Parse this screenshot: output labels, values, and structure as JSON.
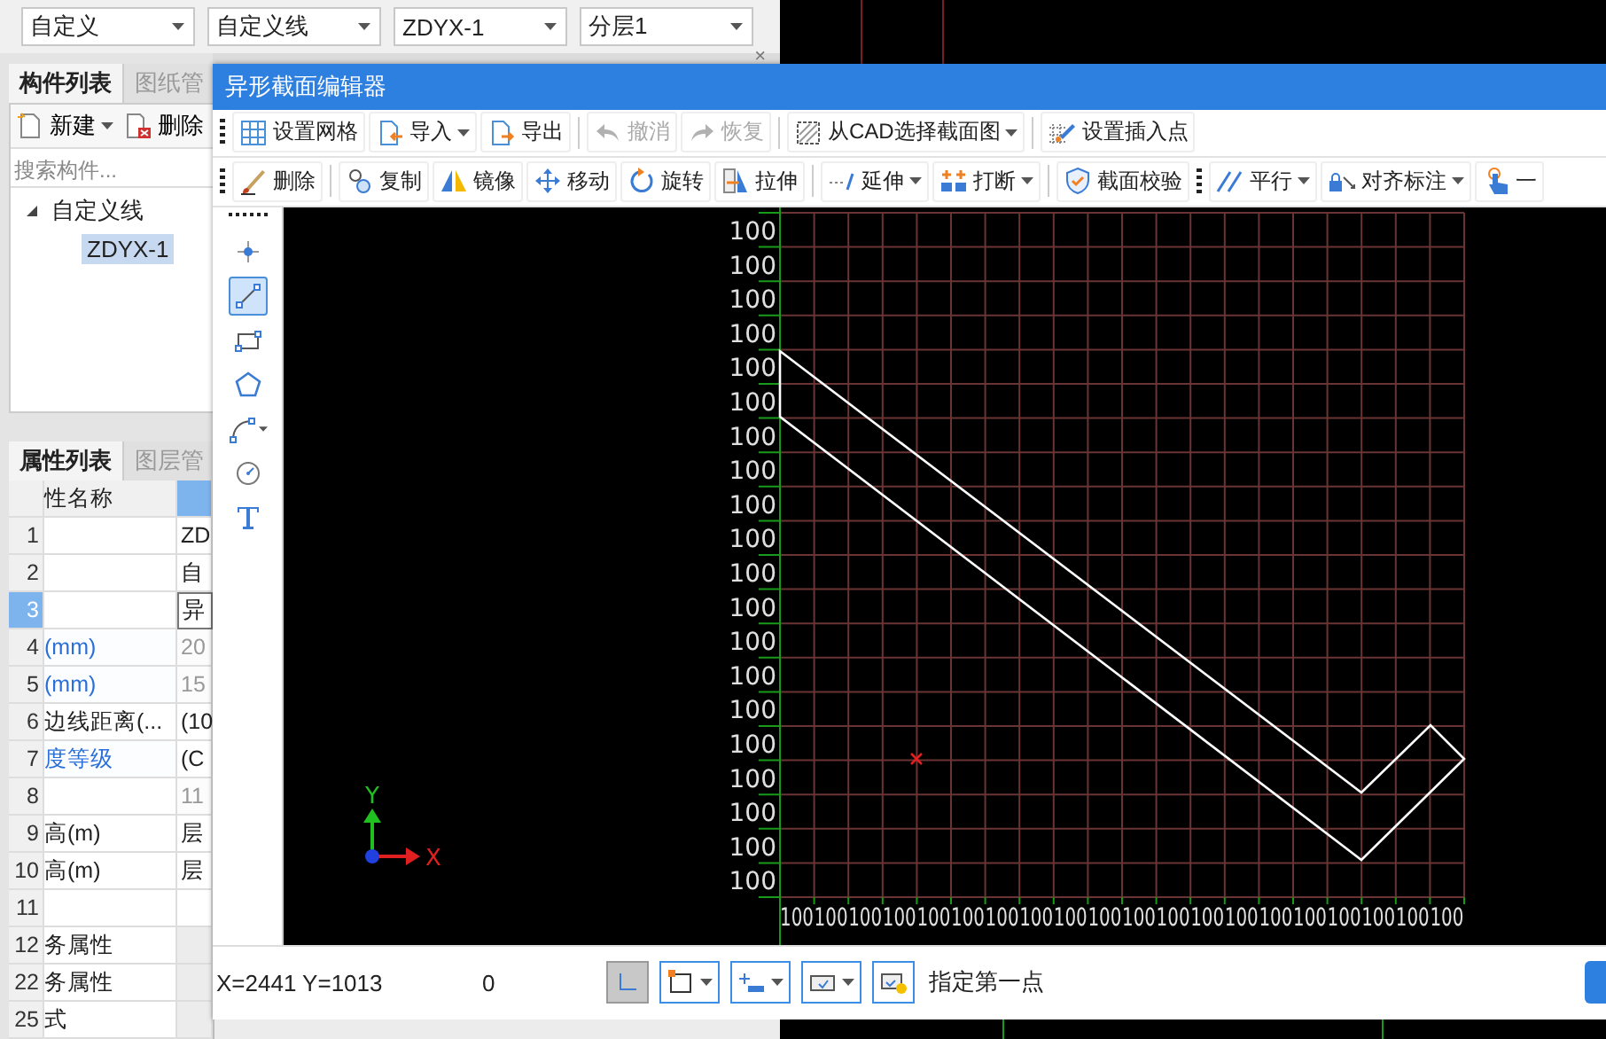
{
  "top_bar": {
    "combos": [
      {
        "value": "自定义"
      },
      {
        "value": "自定义线"
      },
      {
        "value": "ZDYX-1"
      },
      {
        "value": "分层1"
      }
    ],
    "panel_close": "×"
  },
  "component_panel": {
    "tabs": [
      {
        "label": "构件列表",
        "selected": true
      },
      {
        "label": "图纸管",
        "selected": false
      }
    ],
    "actions": [
      {
        "label": "新建",
        "dropdown": true
      },
      {
        "label": "删除",
        "dropdown": false
      }
    ],
    "search": {
      "placeholder": "搜索构件..."
    },
    "tree": [
      {
        "label": "自定义线",
        "expanded": true,
        "selected": false,
        "children": [
          {
            "label": "ZDYX-1",
            "selected": true
          }
        ]
      }
    ]
  },
  "property_panel": {
    "tabs": [
      {
        "label": "属性列表",
        "selected": true
      },
      {
        "label": "图层管",
        "selected": false
      }
    ],
    "columns": [
      {
        "label": "性名称"
      }
    ],
    "rows": [
      {
        "num": "1",
        "value": "ZD",
        "selected": false,
        "readonly": false,
        "kind": "field"
      },
      {
        "num": "2",
        "value": "自",
        "selected": false,
        "readonly": false,
        "kind": "field"
      },
      {
        "num": "3",
        "value": "异",
        "selected": true,
        "public": false,
        "readonly": false,
        "kind": "field"
      },
      {
        "num": "4",
        "name": "(mm)",
        "value": "20",
        "selected": false,
        "public": true,
        "readonly": true,
        "kind": "field"
      },
      {
        "num": "5",
        "name": "(mm)",
        "value": "15",
        "selected": false,
        "public": true,
        "readonly": true,
        "kind": "field"
      },
      {
        "num": "6",
        "name": "边线距离(...",
        "value": "(10",
        "selected": false,
        "public": false,
        "readonly": false,
        "kind": "field"
      },
      {
        "num": "7",
        "name": "度等级",
        "value": "(C",
        "selected": false,
        "public": true,
        "readonly": false,
        "kind": "field"
      },
      {
        "num": "8",
        "value": "11",
        "selected": false,
        "public": false,
        "readonly": true,
        "kind": "field"
      },
      {
        "num": "9",
        "name": "高(m)",
        "value": "层",
        "selected": false,
        "public": false,
        "readonly": false,
        "kind": "field"
      },
      {
        "num": "10",
        "name": "高(m)",
        "value": "层",
        "selected": false,
        "public": false,
        "readonly": false,
        "kind": "field"
      },
      {
        "num": "11",
        "selected": false,
        "readonly": false,
        "kind": "field"
      },
      {
        "num": "12",
        "name": "务属性",
        "selected": false,
        "public": false,
        "readonly": false,
        "kind": "group"
      },
      {
        "num": "22",
        "name": "务属性",
        "selected": false,
        "public": false,
        "readonly": false,
        "kind": "group"
      },
      {
        "num": "25",
        "name": "式",
        "selected": false,
        "public": false,
        "readonly": false,
        "kind": "group"
      }
    ]
  },
  "dialog": {
    "title": "异形截面编辑器",
    "toolbar_1": [
      {
        "kind": "handle"
      },
      {
        "kind": "button",
        "label": "设置网格",
        "dropdown": false,
        "disabled": false
      },
      {
        "kind": "button",
        "label": "导入",
        "dropdown": true,
        "disabled": false
      },
      {
        "kind": "button",
        "label": "导出",
        "dropdown": false,
        "disabled": false
      },
      {
        "kind": "separator"
      },
      {
        "kind": "button",
        "label": "撤消",
        "dropdown": false,
        "disabled": true
      },
      {
        "kind": "button",
        "label": "恢复",
        "dropdown": false,
        "disabled": true
      },
      {
        "kind": "separator"
      },
      {
        "kind": "button",
        "label": "从CAD选择截面图",
        "dropdown": true,
        "disabled": false
      },
      {
        "kind": "separator"
      },
      {
        "kind": "button",
        "label": "设置插入点",
        "dropdown": false,
        "disabled": false
      }
    ],
    "toolbar_2": [
      {
        "kind": "handle"
      },
      {
        "kind": "button",
        "label": "删除",
        "dropdown": false,
        "disabled": false
      },
      {
        "kind": "separator"
      },
      {
        "kind": "button",
        "label": "复制",
        "dropdown": false,
        "disabled": false
      },
      {
        "kind": "button",
        "label": "镜像",
        "dropdown": false,
        "disabled": false
      },
      {
        "kind": "button",
        "label": "移动",
        "dropdown": false,
        "disabled": false
      },
      {
        "kind": "button",
        "label": "旋转",
        "dropdown": false,
        "disabled": false
      },
      {
        "kind": "button",
        "label": "拉伸",
        "dropdown": false,
        "disabled": false
      },
      {
        "kind": "separator"
      },
      {
        "kind": "button",
        "label": "延伸",
        "dropdown": true,
        "disabled": false
      },
      {
        "kind": "button",
        "label": "打断",
        "dropdown": true,
        "disabled": false
      },
      {
        "kind": "separator"
      },
      {
        "kind": "button",
        "label": "截面校验",
        "dropdown": false,
        "disabled": false
      },
      {
        "kind": "handle"
      },
      {
        "kind": "button",
        "label": "平行",
        "dropdown": true,
        "disabled": false
      },
      {
        "kind": "button",
        "label": "对齐标注",
        "dropdown": true,
        "disabled": false
      },
      {
        "kind": "button",
        "label": "一",
        "dropdown": false,
        "disabled": false
      }
    ],
    "tools": [
      {
        "selected": false,
        "dropdown": false
      },
      {
        "selected": true,
        "dropdown": false
      },
      {
        "selected": false,
        "dropdown": false
      },
      {
        "selected": false,
        "dropdown": false
      },
      {
        "selected": false,
        "dropdown": true
      },
      {
        "selected": false,
        "dropdown": false
      },
      {
        "selected": false,
        "dropdown": false
      }
    ],
    "canvas": {
      "y_labels": [
        "100",
        "100",
        "100",
        "100",
        "100",
        "100",
        "100",
        "100",
        "100",
        "100",
        "100",
        "100",
        "100",
        "100",
        "100",
        "100",
        "100",
        "100",
        "100",
        "100"
      ],
      "x_labels": [
        "100",
        "100",
        "100",
        "100",
        "100",
        "100",
        "100",
        "100",
        "100",
        "100",
        "100",
        "100",
        "100",
        "100",
        "100",
        "100",
        "100",
        "100",
        "100",
        "100"
      ],
      "axis": {
        "y": "Y",
        "x": "X"
      }
    },
    "status_bar": {
      "coordinates": "X=2441 Y=1013",
      "value": "0",
      "tools": [
        {
          "on": true,
          "dropdown": false
        },
        {
          "on": false,
          "dropdown": true
        },
        {
          "on": false,
          "dropdown": true
        },
        {
          "on": false,
          "dropdown": true
        },
        {
          "on": false,
          "dropdown": false
        }
      ],
      "prompt": "指定第一点"
    }
  }
}
